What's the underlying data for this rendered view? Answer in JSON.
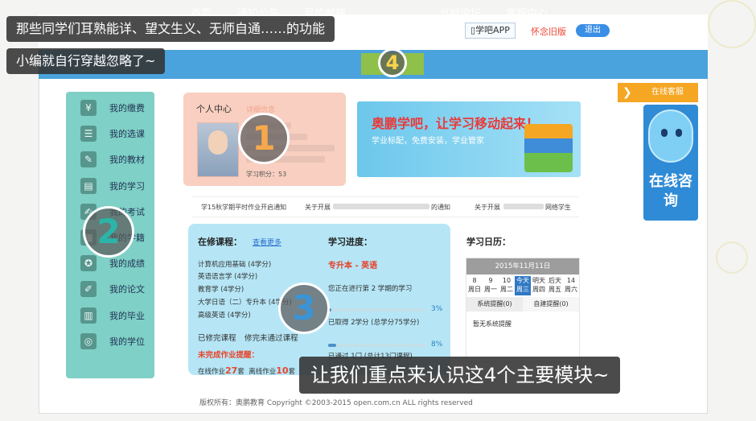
{
  "captions": {
    "top1": "那些同学们耳熟能详、望文生义、无师自通……的功能",
    "top2": "小编就自行穿越忽略了~",
    "bottom": "让我们重点来认识这4个主要模块~"
  },
  "badges": [
    "1",
    "2",
    "3",
    "4"
  ],
  "header": {
    "app_button": "学吧APP",
    "old_version": "怀念旧版",
    "logout": "退出"
  },
  "nav": [
    "首页",
    "通知公告",
    "我的邮箱",
    "",
    "当前论坛",
    "客服中心"
  ],
  "sidebar": [
    {
      "label": "我的缴费",
      "icon": "fee-icon"
    },
    {
      "label": "我的选课",
      "icon": "course-select-icon"
    },
    {
      "label": "我的教材",
      "icon": "textbook-icon"
    },
    {
      "label": "我的学习",
      "icon": "study-icon"
    },
    {
      "label": "我的考试",
      "icon": "exam-icon"
    },
    {
      "label": "我的学籍",
      "icon": "status-icon"
    },
    {
      "label": "我的成绩",
      "icon": "grade-icon"
    },
    {
      "label": "我的论文",
      "icon": "thesis-icon"
    },
    {
      "label": "我的毕业",
      "icon": "graduation-icon"
    },
    {
      "label": "我的学位",
      "icon": "degree-icon"
    }
  ],
  "profile": {
    "title": "个人中心",
    "detail_link": "详细信息",
    "score_line": "学习积分：53"
  },
  "banner": {
    "title": "奥鹏学吧，让学习移动起来！",
    "subtitle": "学业标配，免费安装，学业管家"
  },
  "notices": [
    "学15秋学期平时作业开启通知",
    "关于开展",
    "的通知",
    "关于开展",
    "网络学生"
  ],
  "study": {
    "courses_heading": "在修课程：",
    "more_link": "查看更多",
    "courses": [
      "计算机应用基础 (4学分)",
      "英语语言学 (4学分)",
      "教育学 (4学分)",
      "大学日语（二）专升本 (4学分)",
      "高级英语 (4学分)"
    ],
    "completed": "已修完课程",
    "failed": "修完未通过课程",
    "unfinished_hw": "未完成作业提醒：",
    "online_hw_label": "在线作业",
    "online_hw_count": "27",
    "offline_hw_label": "离线作业",
    "offline_hw_count": "10",
    "unit": "套",
    "progress_heading": "学习进度：",
    "major": "专升本 - 英语",
    "semester_text": "您正在进行第 2 学期的学习",
    "credits_text": "已取得 2学分 (总学分75学分)",
    "credit_pct_label": "3%",
    "credit_pct": 0.03,
    "pass_text": "已通过 1门 (总计13门课程)",
    "pass_pct_label": "8%",
    "pass_pct": 0.08
  },
  "calendar": {
    "heading": "学习日历：",
    "month": "2015年11月11日",
    "days": [
      {
        "num": "8",
        "wd": "周日"
      },
      {
        "num": "9",
        "wd": "周一"
      },
      {
        "num": "10",
        "wd": "周二"
      },
      {
        "num": "今天",
        "wd": "周三",
        "today": true
      },
      {
        "num": "明天",
        "wd": "周四"
      },
      {
        "num": "后天",
        "wd": "周五"
      },
      {
        "num": "14",
        "wd": "周六"
      }
    ],
    "tab_system": "系统提醒(0)",
    "tab_custom": "自建提醒(0)",
    "note": "暂无系统提醒"
  },
  "service": {
    "tab": "在线客服",
    "consult": "在线咨询"
  },
  "footer": "版权所有：奥鹏教育 Copyright ©2003-2015 open.com.cn ALL rights reserved",
  "colors": {
    "nav": "#4aa3dc",
    "active_nav": "#8fc04a",
    "sidebar": "#7fd0c6",
    "profile": "#f8cfc0",
    "study_panel": "#b6e6f6",
    "accent_red": "#e8452c"
  }
}
